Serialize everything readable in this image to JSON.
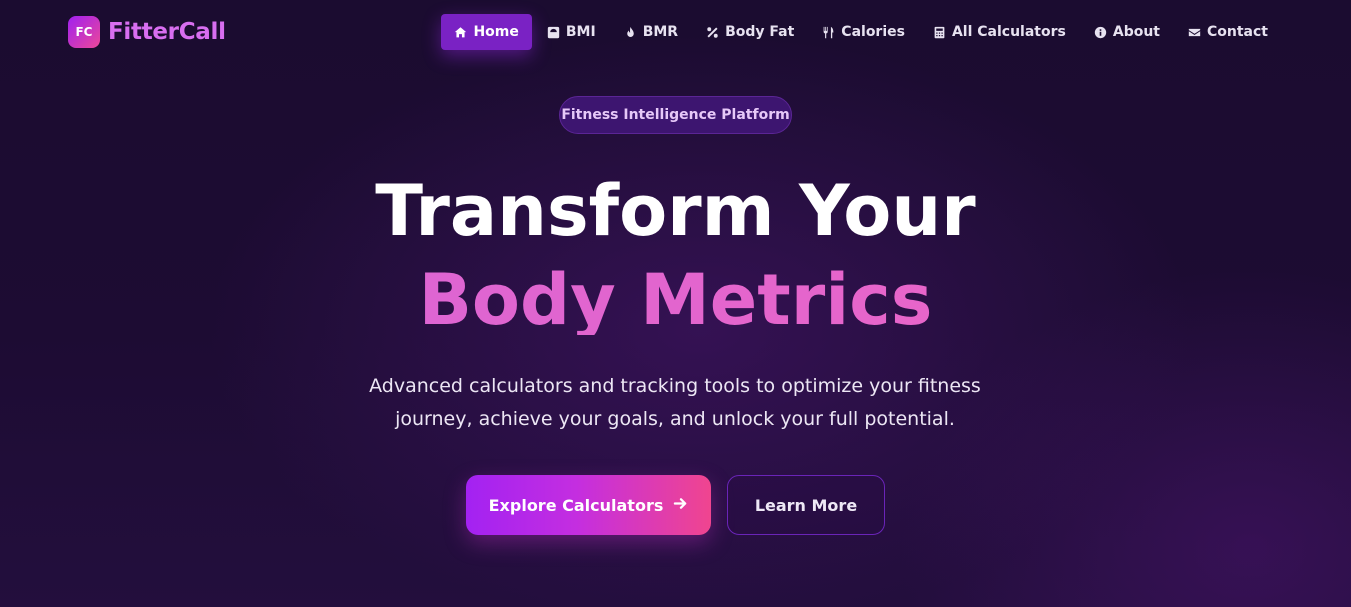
{
  "brand": {
    "badge": "FC",
    "name": "FitterCall"
  },
  "nav": {
    "items": [
      {
        "label": "Home",
        "icon": "home-icon",
        "active": true
      },
      {
        "label": "BMI",
        "icon": "scale-icon",
        "active": false
      },
      {
        "label": "BMR",
        "icon": "fire-icon",
        "active": false
      },
      {
        "label": "Body Fat",
        "icon": "percent-icon",
        "active": false
      },
      {
        "label": "Calories",
        "icon": "utensils-icon",
        "active": false
      },
      {
        "label": "All Calculators",
        "icon": "calculator-icon",
        "active": false
      },
      {
        "label": "About",
        "icon": "info-icon",
        "active": false
      },
      {
        "label": "Contact",
        "icon": "envelope-icon",
        "active": false
      }
    ]
  },
  "hero": {
    "badge": "Fitness Intelligence Platform",
    "title_line1": "Transform Your",
    "title_line2": "Body Metrics",
    "subtitle_line1": "Advanced calculators and tracking tools to optimize your fitness",
    "subtitle_line2": "journey, achieve your goals, and unlock your full potential.",
    "primary_button": "Explore Calculators",
    "secondary_button": "Learn More"
  },
  "colors": {
    "background": "#1b0c30",
    "accent_purple": "#a322f2",
    "accent_pink": "#f0458f",
    "nav_active": "#7a22c4"
  }
}
